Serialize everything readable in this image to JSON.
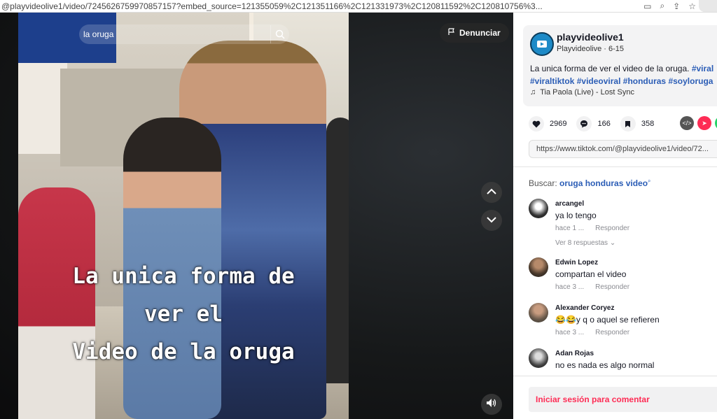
{
  "browser": {
    "url": "@playvideolive1/video/7245626759970857157?embed_source=121355059%2C121351166%2C121331973%2C120811592%2C120810756%3..."
  },
  "video": {
    "search_text": "la oruga",
    "report_label": "Denunciar",
    "caption_lines": [
      "La unica forma de",
      "ver el",
      "Video de la oruga"
    ]
  },
  "author": {
    "username": "playvideolive1",
    "subtitle": "Playvideolive · 6-15"
  },
  "description": {
    "text": "La unica forma de ver el video de la oruga.",
    "hashtags": [
      "#viral",
      "#viraltiktok",
      "#videoviral",
      "#honduras",
      "#soyloruga"
    ],
    "music": "Tia Paola (Live) - Lost Sync"
  },
  "stats": {
    "likes": "2969",
    "comments": "166",
    "saves": "358"
  },
  "link": "https://www.tiktok.com/@playvideolive1/video/72...",
  "search": {
    "prefix": "Buscar:",
    "query": "oruga honduras video"
  },
  "comments": [
    {
      "name": "arcangel",
      "text": "ya lo tengo",
      "time": "hace 1 ...",
      "reply": "Responder",
      "more": "Ver 8 respuestas"
    },
    {
      "name": "Edwin Lopez",
      "text": "compartan el video",
      "time": "hace 3 ...",
      "reply": "Responder"
    },
    {
      "name": "Alexander Coryez",
      "text": "😂😂y q o aquel se refieren",
      "time": "hace 3 ...",
      "reply": "Responder"
    },
    {
      "name": "Adan Rojas",
      "text": "no es nada es algo normal"
    }
  ],
  "login_label": "Iniciar sesión para comentar",
  "colors": {
    "accent": "#fe2c55",
    "hashtag": "#2b5db6"
  }
}
